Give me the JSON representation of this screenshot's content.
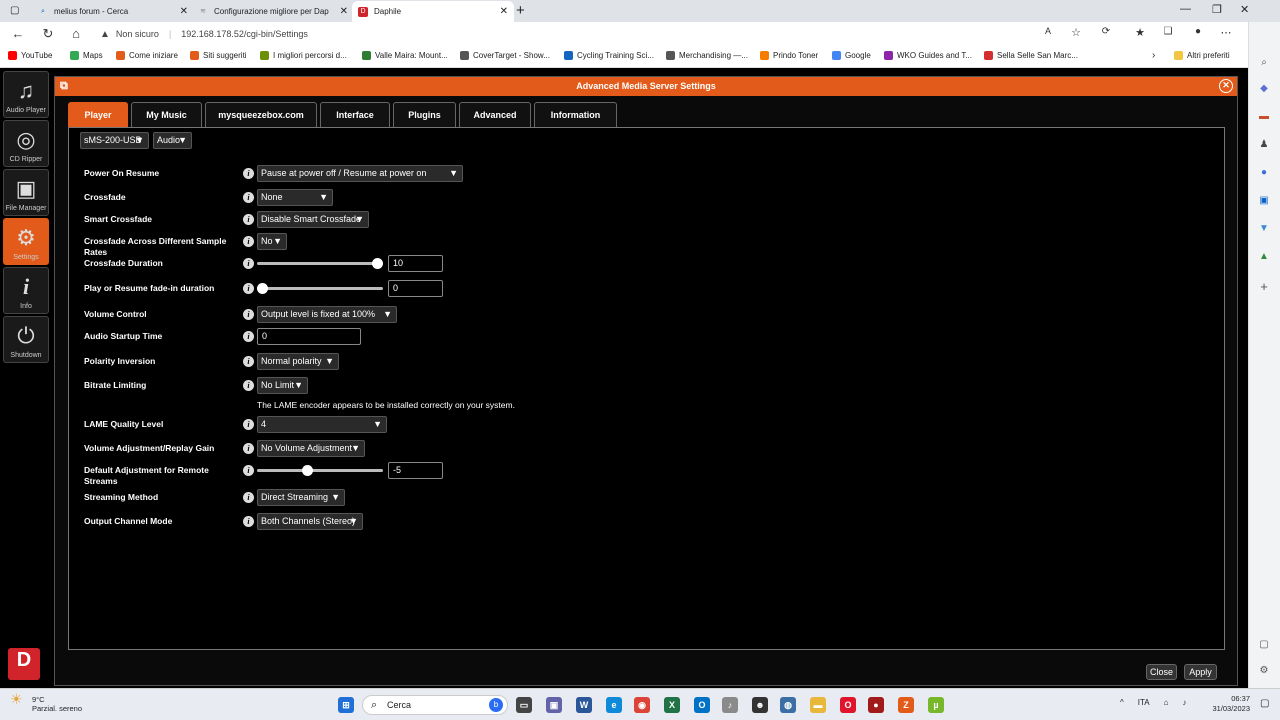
{
  "browser": {
    "tabs": [
      {
        "title": "melius forum - Cerca",
        "icon": "search-icon",
        "color": "#0b57d0"
      },
      {
        "title": "Configurazione migliore per Dap",
        "icon": "forum-icon",
        "color": "#888888"
      },
      {
        "title": "Daphile",
        "icon": "daphile-icon",
        "color": "#d0232a"
      }
    ],
    "new_tab": "+",
    "security_label": "Non sicuro",
    "url": "192.168.178.52/cgi-bin/Settings",
    "bookmarks": [
      {
        "label": "YouTube",
        "color": "#ff0000"
      },
      {
        "label": "Maps",
        "color": "#34a853"
      },
      {
        "label": "Come iniziare",
        "color": "#e25b1a"
      },
      {
        "label": "Siti suggeriti",
        "color": "#e25b1a"
      },
      {
        "label": "I migliori percorsi d...",
        "color": "#6a8f00"
      },
      {
        "label": "Valle Maira: Mount...",
        "color": "#2e7d32"
      },
      {
        "label": "CoverTarget - Show...",
        "color": "#555555"
      },
      {
        "label": "Cycling Training Sci...",
        "color": "#1565c0"
      },
      {
        "label": "Merchandising —...",
        "color": "#555555"
      },
      {
        "label": "Prindo Toner",
        "color": "#f57c00"
      },
      {
        "label": "Google",
        "color": "#4285f4"
      },
      {
        "label": "WKO Guides and T...",
        "color": "#8e24aa"
      },
      {
        "label": "Sella Selle San Marc...",
        "color": "#d32f2f"
      }
    ],
    "other_bookmarks": "Altri preferiti"
  },
  "sidenav": [
    {
      "label": "Audio Player",
      "icon": "music-note-icon",
      "glyph": "♫"
    },
    {
      "label": "CD Ripper",
      "icon": "disc-icon",
      "glyph": "◎"
    },
    {
      "label": "File Manager",
      "icon": "box-icon",
      "glyph": "▣"
    },
    {
      "label": "Settings",
      "icon": "gears-icon",
      "glyph": "⚙"
    },
    {
      "label": "Info",
      "icon": "info-icon",
      "glyph": "i"
    },
    {
      "label": "Shutdown",
      "icon": "power-icon",
      "glyph": "⏻"
    }
  ],
  "dialog": {
    "title": "Advanced Media Server Settings",
    "tabs": [
      "Player",
      "My Music",
      "mysqueezebox.com",
      "Interface",
      "Plugins",
      "Advanced",
      "Information"
    ],
    "player_select": "sMS-200-USB",
    "category_select": "Audio",
    "settings": [
      {
        "label": "Power On Resume",
        "value": "Pause at power off / Resume at power on"
      },
      {
        "label": "Crossfade",
        "value": "None"
      },
      {
        "label": "Smart Crossfade",
        "value": "Disable Smart Crossfade"
      },
      {
        "label": "Crossfade Across Different Sample Rates",
        "value": "No"
      },
      {
        "label": "Crossfade Duration",
        "value": "10",
        "slider": 1.0
      },
      {
        "label": "Play or Resume fade-in duration",
        "value": "0",
        "slider": 0.0
      },
      {
        "label": "Volume Control",
        "value": "Output level is fixed at 100%"
      },
      {
        "label": "Audio Startup Time",
        "value": "0"
      },
      {
        "label": "Polarity Inversion",
        "value": "Normal polarity"
      },
      {
        "label": "Bitrate Limiting",
        "value": "No Limit"
      },
      {
        "label": "LAME Quality Level",
        "value": "4"
      },
      {
        "label": "Volume Adjustment/Replay Gain",
        "value": "No Volume Adjustment"
      },
      {
        "label": "Default Adjustment for Remote Streams",
        "value": "-5",
        "slider": 0.39
      },
      {
        "label": "Streaming Method",
        "value": "Direct Streaming"
      },
      {
        "label": "Output Channel Mode",
        "value": "Both Channels (Stereo)"
      }
    ],
    "lame_note": "The LAME encoder appears to be installed correctly on your system.",
    "close_label": "Close",
    "apply_label": "Apply"
  },
  "taskbar": {
    "weather_temp": "9°C",
    "weather_desc": "Parzial. sereno",
    "search_placeholder": "Cerca",
    "language": "ITA",
    "time": "06:37",
    "date": "31/03/2023"
  }
}
